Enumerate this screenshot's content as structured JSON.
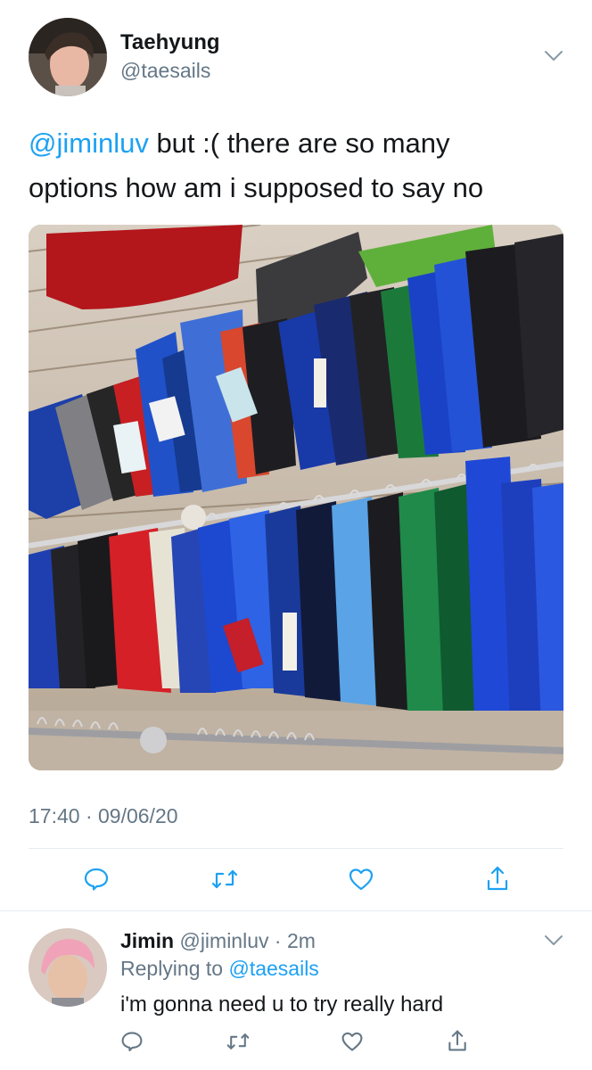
{
  "tweet": {
    "author_name": "Taehyung",
    "author_handle": "@taesails",
    "text_mention": "@jiminluv",
    "text_line1": " but :( there are so many",
    "text_line2": "options how am i supposed to say no",
    "timestamp": "17:40 · 09/06/20"
  },
  "reply": {
    "author_name": "Jimin",
    "author_handle": "@jiminluv",
    "time": "· 2m",
    "replying_prefix": "Replying to",
    "replying_handle": "@taesails",
    "text": "i'm gonna need u to try really hard"
  },
  "icons": {
    "reply": "comment-icon",
    "retweet": "retweet-icon",
    "like": "heart-icon",
    "share": "share-icon",
    "menu": "chevron-down-icon"
  },
  "colors": {
    "accent": "#1da1f2",
    "muted": "#657786",
    "divider": "#e6ecf0"
  }
}
